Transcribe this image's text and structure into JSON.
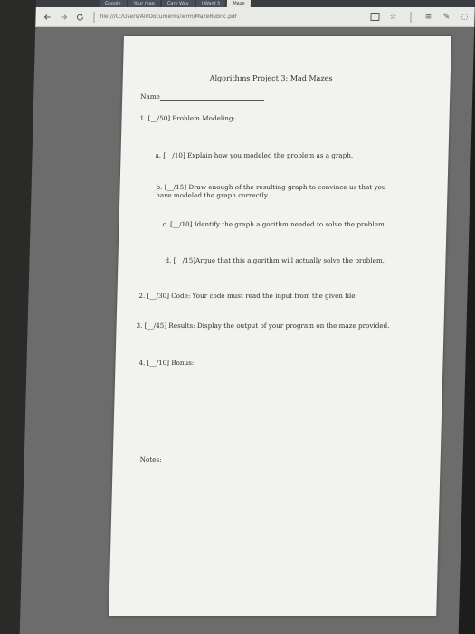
{
  "browser": {
    "tabs": [
      "Google",
      "Your map",
      "Cary Way",
      "I Want 5",
      "Maze"
    ],
    "address_url": "file:///C:/Users/Ali/Documents/wrm/MazeRubric.pdf",
    "icons": [
      "back-icon",
      "forward-icon",
      "refresh-icon",
      "reading-view-icon",
      "favorite-star-icon",
      "hub-icon",
      "web-note-icon",
      "share-icon"
    ]
  },
  "document": {
    "title": "Algorithms Project 3: Mad Mazes",
    "name_label": "Name",
    "items": [
      "1. [__/50] Problem Modeling:",
      "a. [__/10] Explain how you modeled the problem as a graph.",
      "b. [__/15] Draw enough of the resulting graph to convince us that you have modeled the graph correctly.",
      "c. [__/10] Identify the graph algorithm needed to solve the problem.",
      "d. [__/15]Argue that this algorithm will actually solve the problem.",
      "2. [__/30] Code: Your code must read the input from the given file.",
      "3. [__/45] Results: Display the output of your program on the maze provided.",
      "4. [__/10] Bonus:"
    ],
    "notes_label": "Notes:"
  }
}
